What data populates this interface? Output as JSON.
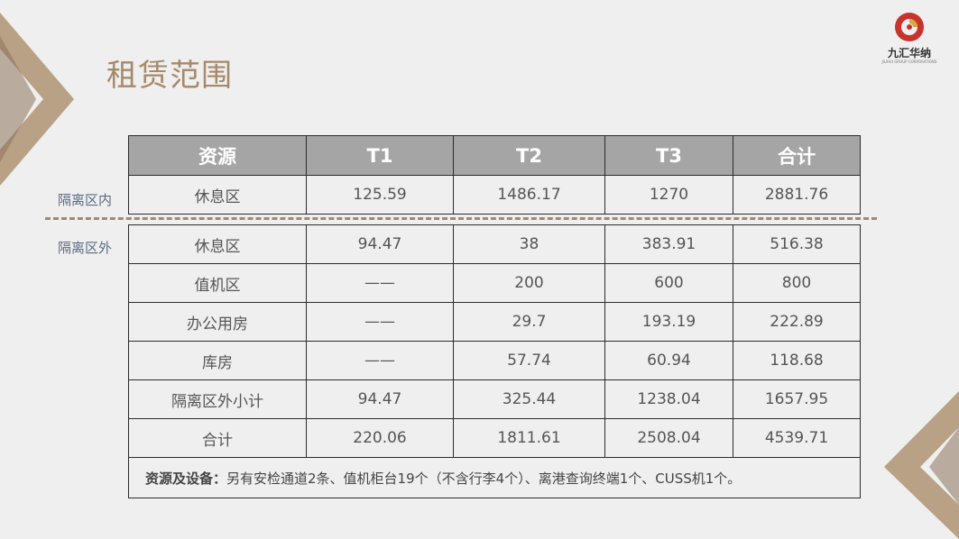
{
  "slide": {
    "title": "租赁范围",
    "logo": {
      "name": "九汇华纳",
      "sub": "JIUHUI GROUP CORPORATIONS"
    },
    "colors": {
      "accent": "#a6896a",
      "header_bg": "#a5a5a5",
      "label": "#5a6b84"
    }
  },
  "regions": {
    "inside": "隔离区内",
    "outside": "隔离区外"
  },
  "table": {
    "headers": [
      "资源",
      "T1",
      "T2",
      "T3",
      "合计"
    ],
    "inside_rows": [
      {
        "name": "休息区",
        "t1": "125.59",
        "t2": "1486.17",
        "t3": "1270",
        "total": "2881.76"
      }
    ],
    "outside_rows": [
      {
        "name": "休息区",
        "t1": "94.47",
        "t2": "38",
        "t3": "383.91",
        "total": "516.38"
      },
      {
        "name": "值机区",
        "t1": "——",
        "t2": "200",
        "t3": "600",
        "total": "800"
      },
      {
        "name": "办公用房",
        "t1": "——",
        "t2": "29.7",
        "t3": "193.19",
        "total": "222.89"
      },
      {
        "name": "库房",
        "t1": "——",
        "t2": "57.74",
        "t3": "60.94",
        "total": "118.68"
      },
      {
        "name": "隔离区外小计",
        "t1": "94.47",
        "t2": "325.44",
        "t3": "1238.04",
        "total": "1657.95"
      }
    ],
    "grand_total": {
      "name": "合计",
      "t1": "220.06",
      "t2": "1811.61",
      "t3": "2508.04",
      "total": "4539.71"
    },
    "note": {
      "label": "资源及设备：",
      "text": "另有安检通道2条、值机柜台19个（不含行李4个）、离港查询终端1个、CUSS机1个。"
    }
  }
}
